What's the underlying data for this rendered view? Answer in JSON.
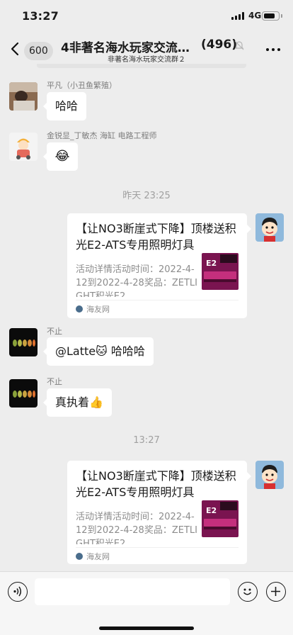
{
  "status_bar": {
    "time": "13:27",
    "network": "4G",
    "battery_level": 0.8
  },
  "nav": {
    "back_count": "600",
    "title": "4非著名海水玩家交流…",
    "member_count": "(496)",
    "subtitle": "非著名海水玩家交流群２",
    "icons": {
      "back": "chevron-left-icon",
      "muted": "mute-bell-icon",
      "more": "more-dots-icon"
    }
  },
  "messages": [
    {
      "type": "text",
      "sender": "平凡（小丑鱼繁殖）",
      "text": "哈哈",
      "avatar": "photo-avatar"
    },
    {
      "type": "sticker",
      "sender": "金锐显_丁敏杰 海缸 电路工程师",
      "emoji": "😂",
      "avatar": "cartoon-avatar"
    },
    {
      "type": "timestamp",
      "text": "昨天 23:25"
    },
    {
      "type": "link_card",
      "self": true,
      "title": "【让NO3断崖式下降】顶楼送积光E2-ATS专用照明灯具",
      "desc": "活动详情活动时间：2022-4-12到2022-4-28奖品：ZETLIGHT积光E2...",
      "source": "海友网",
      "thumb_label": "E2"
    },
    {
      "type": "text",
      "sender": "不止",
      "text": "@Latte🐱 哈哈哈",
      "avatar": "dark-avatar"
    },
    {
      "type": "text",
      "sender": "不止",
      "text": "真执着👍",
      "avatar": "dark-avatar"
    },
    {
      "type": "timestamp",
      "text": "13:27"
    },
    {
      "type": "link_card",
      "self": true,
      "title": "【让NO3断崖式下降】顶楼送积光E2-ATS专用照明灯具",
      "desc": "活动详情活动时间：2022-4-12到2022-4-28奖品：ZETLIGHT积光E2...",
      "source": "海友网",
      "thumb_label": "E2"
    }
  ],
  "input_bar": {
    "value": "",
    "icons": {
      "voice": "voice-icon",
      "emoji": "emoji-icon",
      "plus": "plus-icon"
    }
  },
  "colors": {
    "background": "#ededed",
    "bubble": "#ffffff",
    "muted_text": "#7d7d7d"
  }
}
